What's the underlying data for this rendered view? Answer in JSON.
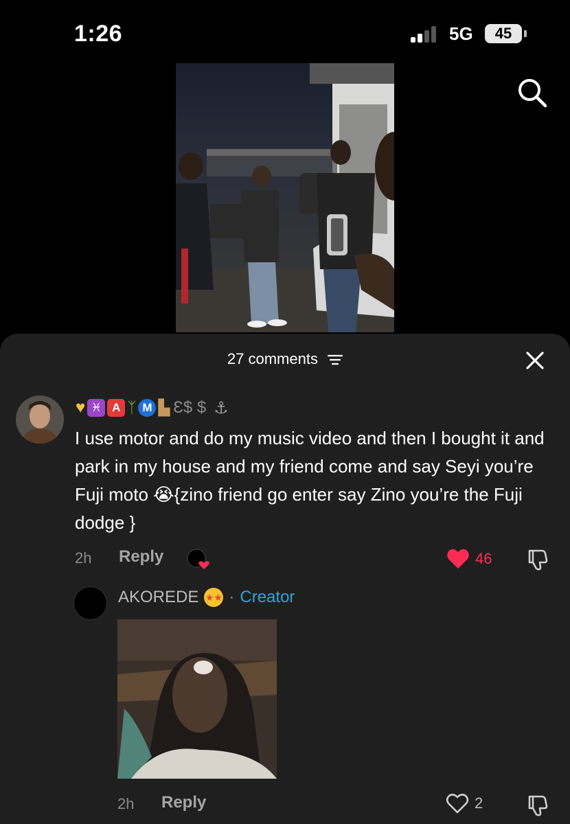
{
  "status_bar": {
    "time": "1:26",
    "network": "5G",
    "battery": "45"
  },
  "video": {
    "description": "video"
  },
  "comments_sheet": {
    "count_label": "27 comments",
    "comment": {
      "username_symbols": "Ɛ$ $",
      "text": "I use motor and do my music video and then I bought it and park in my house and my friend come and say Seyi you’re Fuji moto 😭{zino friend go enter say Zino you’re the Fuji dodge }",
      "time": "2h",
      "reply_label": "Reply",
      "likes": "46"
    },
    "reply": {
      "username": "AKOREDE",
      "separator": "·",
      "creator_label": "Creator",
      "time": "2h",
      "reply_label": "Reply",
      "likes": "2"
    }
  },
  "colors": {
    "like_red": "#fe2c55",
    "creator_blue": "#2da7d4",
    "sheet_bg": "#1f1f1f"
  },
  "icons": [
    "search-icon",
    "filter-icon",
    "close-icon",
    "heart-icon",
    "dislike-icon",
    "creator-liked-icon"
  ]
}
